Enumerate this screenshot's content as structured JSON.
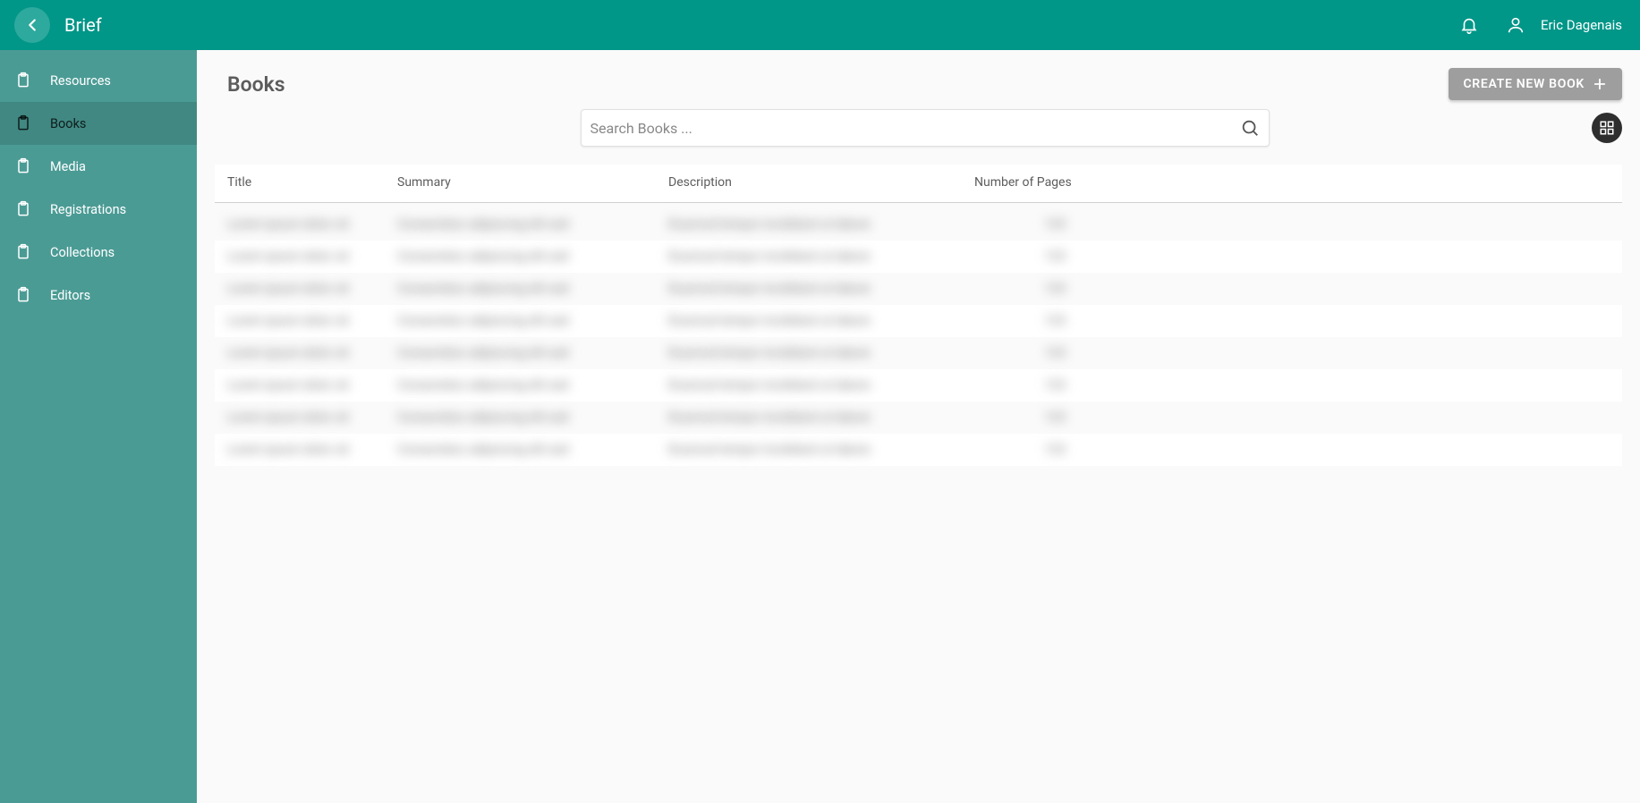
{
  "header": {
    "app_title": "Brief",
    "user_name": "Eric Dagenais"
  },
  "sidebar": {
    "items": [
      {
        "label": "Resources",
        "active": false
      },
      {
        "label": "Books",
        "active": true
      },
      {
        "label": "Media",
        "active": false
      },
      {
        "label": "Registrations",
        "active": false
      },
      {
        "label": "Collections",
        "active": false
      },
      {
        "label": "Editors",
        "active": false
      }
    ]
  },
  "main": {
    "page_title": "Books",
    "create_button_label": "CREATE NEW BOOK",
    "search_placeholder": "Search Books ...",
    "columns": {
      "title": "Title",
      "summary": "Summary",
      "description": "Description",
      "pages": "Number of Pages"
    },
    "rows": [
      {
        "title": "Lorem ipsum dolor sit",
        "summary": "Consectetur adipiscing elit sed",
        "description": "Eiusmod tempor incididunt ut labore",
        "pages": "123"
      },
      {
        "title": "Lorem ipsum dolor sit",
        "summary": "Consectetur adipiscing elit sed",
        "description": "Eiusmod tempor incididunt ut labore",
        "pages": "123"
      },
      {
        "title": "Lorem ipsum dolor sit",
        "summary": "Consectetur adipiscing elit sed",
        "description": "Eiusmod tempor incididunt ut labore",
        "pages": "123"
      },
      {
        "title": "Lorem ipsum dolor sit",
        "summary": "Consectetur adipiscing elit sed",
        "description": "Eiusmod tempor incididunt ut labore",
        "pages": "123"
      },
      {
        "title": "Lorem ipsum dolor sit",
        "summary": "Consectetur adipiscing elit sed",
        "description": "Eiusmod tempor incididunt ut labore",
        "pages": "123"
      },
      {
        "title": "Lorem ipsum dolor sit",
        "summary": "Consectetur adipiscing elit sed",
        "description": "Eiusmod tempor incididunt ut labore",
        "pages": "123"
      },
      {
        "title": "Lorem ipsum dolor sit",
        "summary": "Consectetur adipiscing elit sed",
        "description": "Eiusmod tempor incididunt ut labore",
        "pages": "123"
      },
      {
        "title": "Lorem ipsum dolor sit",
        "summary": "Consectetur adipiscing elit sed",
        "description": "Eiusmod tempor incididunt ut labore",
        "pages": "123"
      }
    ]
  }
}
